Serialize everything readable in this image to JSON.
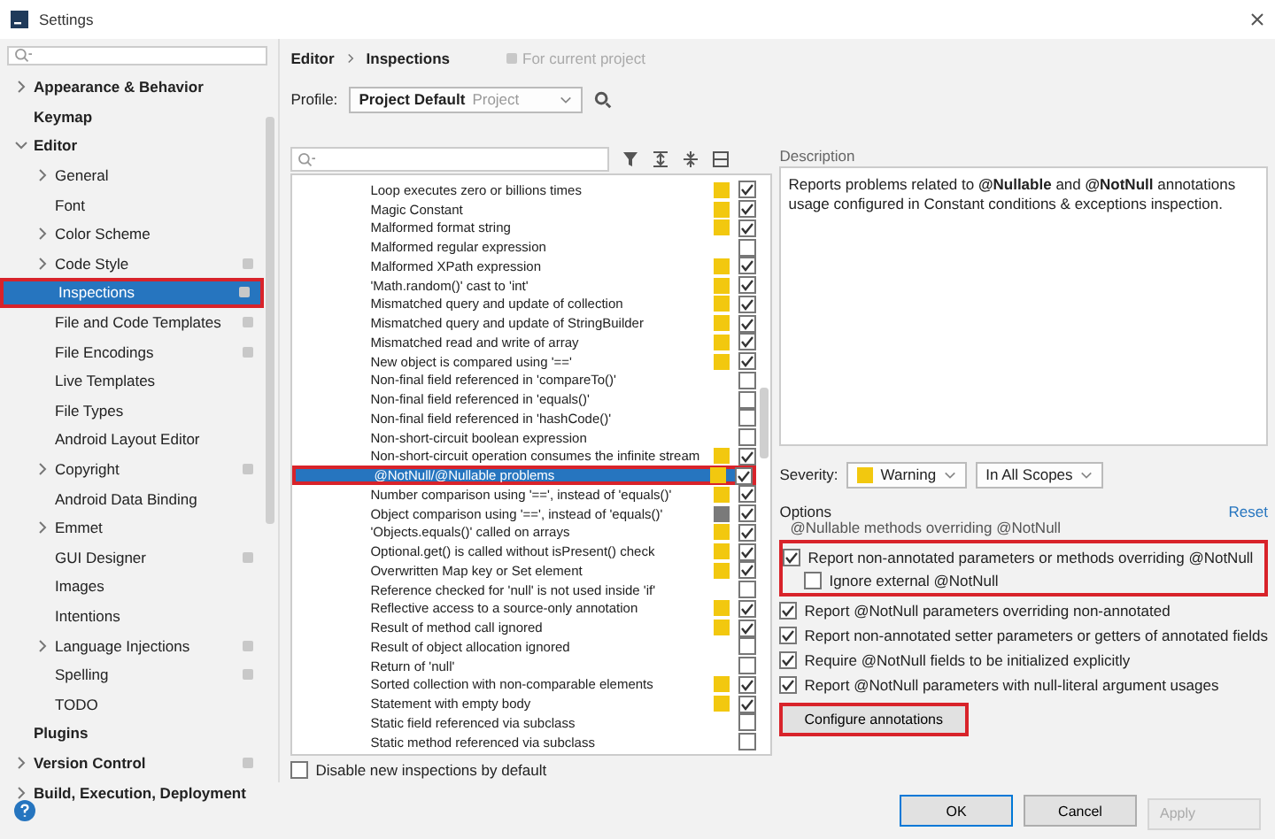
{
  "window": {
    "title": "Settings"
  },
  "sidebar": {
    "items": [
      {
        "label": "Appearance & Behavior",
        "expanded": false
      },
      {
        "label": "Keymap"
      },
      {
        "label": "Editor",
        "expanded": true,
        "children": [
          {
            "label": "General",
            "expanded": false,
            "selected": false,
            "project": false,
            "highlighted": false
          },
          {
            "label": "Font",
            "selected": false,
            "project": false,
            "highlighted": false
          },
          {
            "label": "Color Scheme",
            "expanded": false,
            "selected": false,
            "project": false,
            "highlighted": false
          },
          {
            "label": "Code Style",
            "expanded": false,
            "selected": false,
            "project": true,
            "highlighted": false
          },
          {
            "label": "Inspections",
            "selected": true,
            "project": true,
            "highlighted": true
          },
          {
            "label": "File and Code Templates",
            "selected": false,
            "project": true,
            "highlighted": false
          },
          {
            "label": "File Encodings",
            "selected": false,
            "project": true,
            "highlighted": false
          },
          {
            "label": "Live Templates",
            "selected": false,
            "project": false,
            "highlighted": false
          },
          {
            "label": "File Types",
            "selected": false,
            "project": false,
            "highlighted": false
          },
          {
            "label": "Android Layout Editor",
            "selected": false,
            "project": false,
            "highlighted": false
          },
          {
            "label": "Copyright",
            "expanded": false,
            "selected": false,
            "project": true,
            "highlighted": false
          },
          {
            "label": "Android Data Binding",
            "selected": false,
            "project": false,
            "highlighted": false
          },
          {
            "label": "Emmet",
            "expanded": false,
            "selected": false,
            "project": false,
            "highlighted": false
          },
          {
            "label": "GUI Designer",
            "selected": false,
            "project": true,
            "highlighted": false
          },
          {
            "label": "Images",
            "selected": false,
            "project": false,
            "highlighted": false
          },
          {
            "label": "Intentions",
            "selected": false,
            "project": false,
            "highlighted": false
          },
          {
            "label": "Language Injections",
            "expanded": false,
            "selected": false,
            "project": true,
            "highlighted": false
          },
          {
            "label": "Spelling",
            "selected": false,
            "project": true,
            "highlighted": false
          },
          {
            "label": "TODO",
            "selected": false,
            "project": false,
            "highlighted": false
          }
        ]
      },
      {
        "label": "Plugins"
      },
      {
        "label": "Version Control",
        "expanded": false,
        "project": true
      },
      {
        "label": "Build, Execution, Deployment",
        "expanded": false
      }
    ]
  },
  "breadcrumb": {
    "parent": "Editor",
    "current": "Inspections",
    "scope": "For current project"
  },
  "profile": {
    "label": "Profile:",
    "value": "Project Default",
    "tag": "Project"
  },
  "inspections": [
    {
      "label": "Loop executes zero or billions times",
      "color": "#f2c80f",
      "checked": true,
      "selected": false,
      "highlighted": false
    },
    {
      "label": "Magic Constant",
      "color": "#f2c80f",
      "checked": true,
      "selected": false,
      "highlighted": false
    },
    {
      "label": "Malformed format string",
      "color": "#f2c80f",
      "checked": true,
      "selected": false,
      "highlighted": false
    },
    {
      "label": "Malformed regular expression",
      "checked": false,
      "selected": false,
      "highlighted": false
    },
    {
      "label": "Malformed XPath expression",
      "color": "#f2c80f",
      "checked": true,
      "selected": false,
      "highlighted": false
    },
    {
      "label": "'Math.random()' cast to 'int'",
      "color": "#f2c80f",
      "checked": true,
      "selected": false,
      "highlighted": false
    },
    {
      "label": "Mismatched query and update of collection",
      "color": "#f2c80f",
      "checked": true,
      "selected": false,
      "highlighted": false
    },
    {
      "label": "Mismatched query and update of StringBuilder",
      "color": "#f2c80f",
      "checked": true,
      "selected": false,
      "highlighted": false
    },
    {
      "label": "Mismatched read and write of array",
      "color": "#f2c80f",
      "checked": true,
      "selected": false,
      "highlighted": false
    },
    {
      "label": "New object is compared using '=='",
      "color": "#f2c80f",
      "checked": true,
      "selected": false,
      "highlighted": false
    },
    {
      "label": "Non-final field referenced in 'compareTo()'",
      "checked": false,
      "selected": false,
      "highlighted": false
    },
    {
      "label": "Non-final field referenced in 'equals()'",
      "checked": false,
      "selected": false,
      "highlighted": false
    },
    {
      "label": "Non-final field referenced in 'hashCode()'",
      "checked": false,
      "selected": false,
      "highlighted": false
    },
    {
      "label": "Non-short-circuit boolean expression",
      "checked": false,
      "selected": false,
      "highlighted": false
    },
    {
      "label": "Non-short-circuit operation consumes the infinite stream",
      "color": "#f2c80f",
      "checked": true,
      "selected": false,
      "highlighted": false
    },
    {
      "label": "@NotNull/@Nullable problems",
      "color": "#f2c80f",
      "checked": true,
      "selected": true,
      "highlighted": true
    },
    {
      "label": "Number comparison using '==', instead of 'equals()'",
      "color": "#f2c80f",
      "checked": true,
      "selected": false,
      "highlighted": false
    },
    {
      "label": "Object comparison using '==', instead of 'equals()'",
      "color": "#7a7a7a",
      "checked": true,
      "selected": false,
      "highlighted": false
    },
    {
      "label": "'Objects.equals()' called on arrays",
      "color": "#f2c80f",
      "checked": true,
      "selected": false,
      "highlighted": false
    },
    {
      "label": "Optional.get() is called without isPresent() check",
      "color": "#f2c80f",
      "checked": true,
      "selected": false,
      "highlighted": false
    },
    {
      "label": "Overwritten Map key or Set element",
      "color": "#f2c80f",
      "checked": true,
      "selected": false,
      "highlighted": false
    },
    {
      "label": "Reference checked for 'null' is not used inside 'if'",
      "checked": false,
      "selected": false,
      "highlighted": false
    },
    {
      "label": "Reflective access to a source-only annotation",
      "color": "#f2c80f",
      "checked": true,
      "selected": false,
      "highlighted": false
    },
    {
      "label": "Result of method call ignored",
      "color": "#f2c80f",
      "checked": true,
      "selected": false,
      "highlighted": false
    },
    {
      "label": "Result of object allocation ignored",
      "checked": false,
      "selected": false,
      "highlighted": false
    },
    {
      "label": "Return of 'null'",
      "checked": false,
      "selected": false,
      "highlighted": false
    },
    {
      "label": "Sorted collection with non-comparable elements",
      "color": "#f2c80f",
      "checked": true,
      "selected": false,
      "highlighted": false
    },
    {
      "label": "Statement with empty body",
      "color": "#f2c80f",
      "checked": true,
      "selected": false,
      "highlighted": false
    },
    {
      "label": "Static field referenced via subclass",
      "checked": false,
      "selected": false,
      "highlighted": false
    },
    {
      "label": "Static method referenced via subclass",
      "checked": false,
      "selected": false,
      "highlighted": false
    }
  ],
  "disable_new": {
    "label": "Disable new inspections by default",
    "checked": false
  },
  "description": {
    "heading": "Description",
    "text": "Reports problems related to **@Nullable** and **@NotNull** annotations usage configured in Constant conditions & exceptions inspection."
  },
  "severity": {
    "label": "Severity:",
    "value": "Warning",
    "color": "#f2c80f",
    "scope": "In All Scopes"
  },
  "options": {
    "heading": "Options",
    "reset": "Reset",
    "cut_line": "@Nullable methods overriding @NotNull",
    "items": [
      {
        "label": "Report non-annotated parameters or methods overriding @NotNull",
        "checked": true,
        "highlighted": true,
        "children": [
          {
            "label": "Ignore external @NotNull",
            "checked": false,
            "highlighted": false
          }
        ]
      },
      {
        "label": "Report @NotNull parameters overriding non-annotated",
        "checked": true,
        "highlighted": false
      },
      {
        "label": "Report non-annotated setter parameters or getters of annotated fields",
        "checked": true,
        "highlighted": false
      },
      {
        "label": "Require @NotNull fields to be initialized explicitly",
        "checked": true,
        "highlighted": false
      },
      {
        "label": "Report @NotNull parameters with null-literal argument usages",
        "checked": true,
        "highlighted": false
      }
    ],
    "button": {
      "label": "Configure annotations",
      "highlighted": true
    }
  },
  "buttons": [
    {
      "label": "OK",
      "kind": "default",
      "disabled": false
    },
    {
      "label": "Cancel",
      "kind": "normal",
      "disabled": false
    },
    {
      "label": "Apply",
      "kind": "normal",
      "disabled": true
    }
  ]
}
